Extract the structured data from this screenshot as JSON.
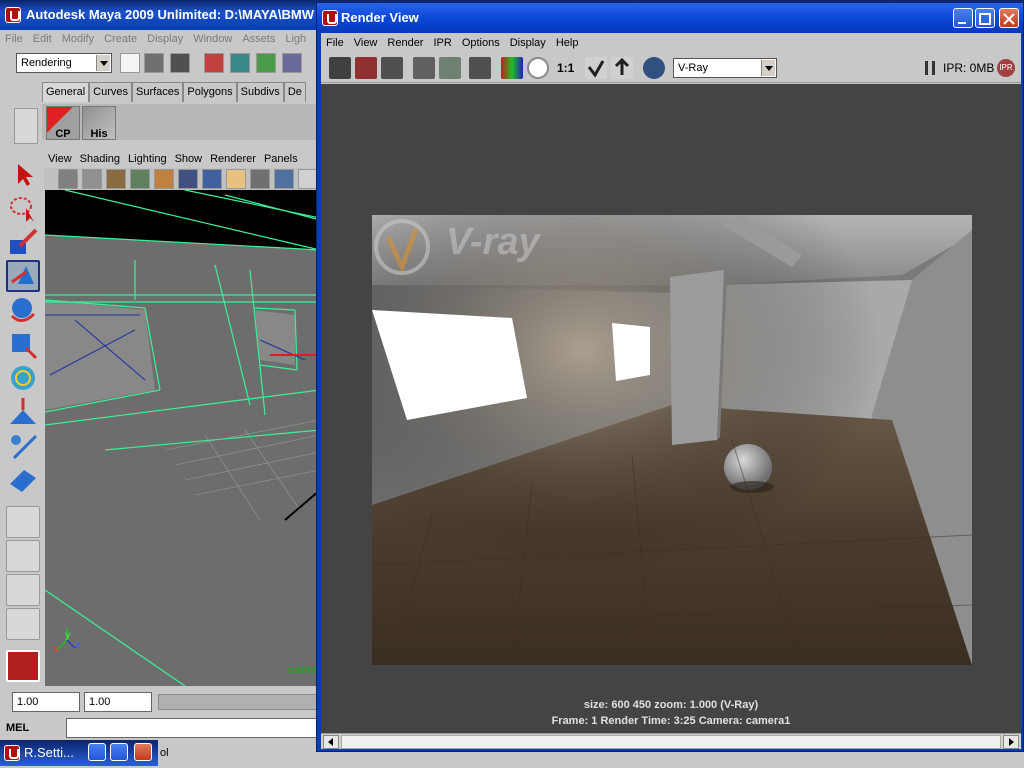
{
  "maya": {
    "title": "Autodesk Maya 2009 Unlimited: D:\\MAYA\\BMW",
    "menu": [
      "File",
      "Edit",
      "Modify",
      "Create",
      "Display",
      "Window",
      "Assets",
      "Ligh"
    ],
    "menu_set": "Rendering",
    "shelf_tabs": [
      "General",
      "Curves",
      "Surfaces",
      "Polygons",
      "Subdivs",
      "De"
    ],
    "shelf_buttons": [
      "CP",
      "His"
    ],
    "viewport_menu": [
      "View",
      "Shading",
      "Lighting",
      "Show",
      "Renderer",
      "Panels"
    ],
    "viewport_camera_label": "came",
    "axis_y": "y",
    "axis_x": "x",
    "axis_z": "z",
    "time_start": "1.00",
    "time_current": "1.00",
    "mel_label": "MEL",
    "mel_text": "ol",
    "minimized_window": "R.Setti..."
  },
  "render_view": {
    "title": "Render View",
    "menu": [
      "File",
      "View",
      "Render",
      "IPR",
      "Options",
      "Display",
      "Help"
    ],
    "renderer": "V-Ray",
    "zoom_label": "1:1",
    "ipr_status": "IPR: 0MB",
    "ipr_badge": "IPR",
    "info_line1": "size:  600  450 zoom: 1.000      (V-Ray)",
    "info_line2": "Frame: 1      Render Time:  3:25        Camera: camera1",
    "watermark": "V-ray"
  },
  "colors": {
    "xp_title": "#0a48d8",
    "wire_green": "#3cf09a",
    "canvas_bg": "#444444"
  }
}
